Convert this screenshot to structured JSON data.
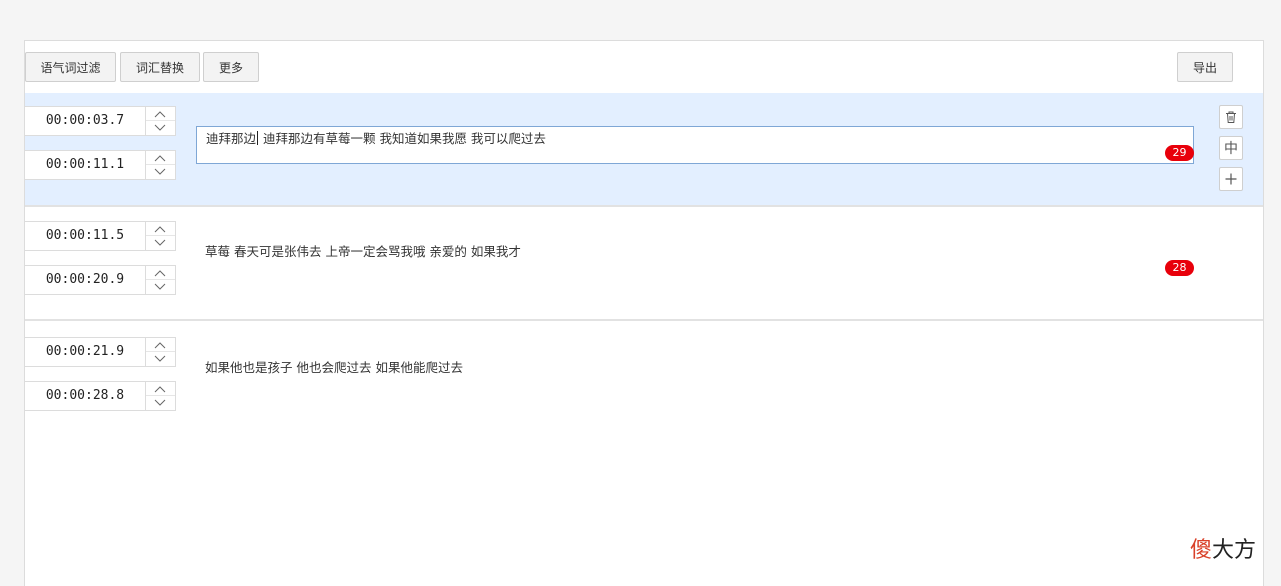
{
  "toolbar": {
    "filter_label": "语气词过滤",
    "replace_label": "词汇替换",
    "more_label": "更多",
    "export_label": "导出"
  },
  "rows": [
    {
      "start": "00:00:03.7",
      "end": "00:00:11.1",
      "text_before_caret": "迪拜那边",
      "text_after_caret": " 迪拜那边有草莓一颗 我知道如果我愿 我可以爬过去",
      "count": "29",
      "active": true
    },
    {
      "start": "00:00:11.5",
      "end": "00:00:20.9",
      "text": "草莓 春天可是张伟去 上帝一定会骂我哦 亲爱的 如果我才",
      "count": "28"
    },
    {
      "start": "00:00:21.9",
      "end": "00:00:28.8",
      "text": "如果他也是孩子 他也会爬过去 如果他能爬过去"
    }
  ],
  "row_actions": {
    "delete_icon": "trash-icon",
    "split_label": "中",
    "add_label": "+"
  },
  "watermark": {
    "part1": "傻",
    "part2": "大方"
  }
}
